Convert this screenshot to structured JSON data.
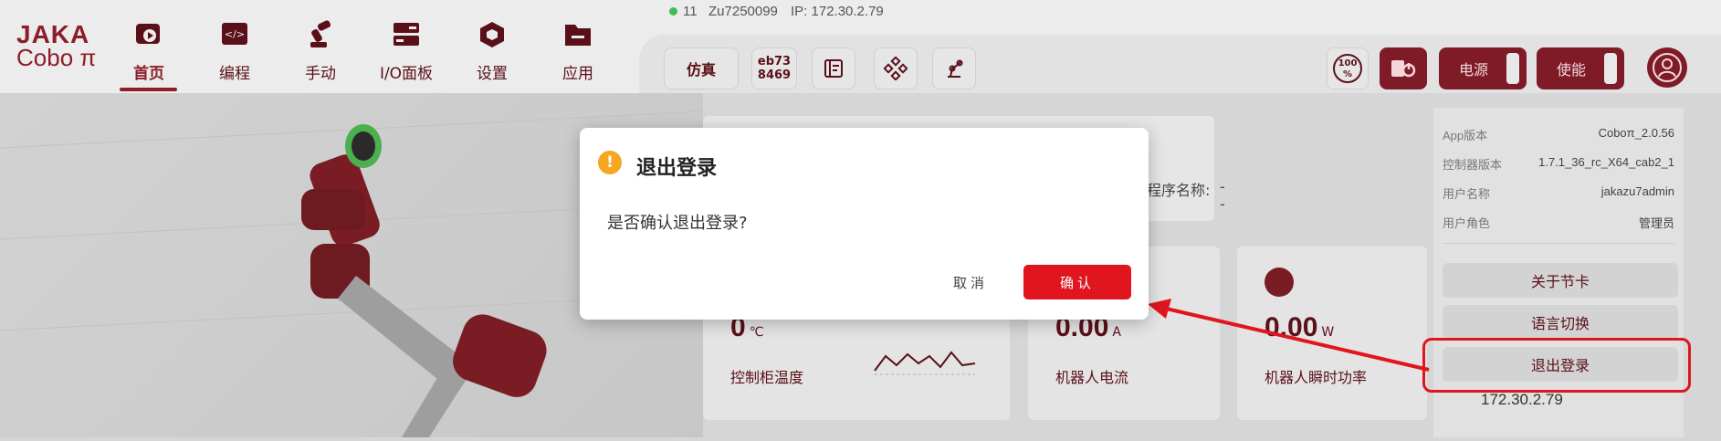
{
  "status": {
    "count": "11",
    "serial": "Zu7250099",
    "ip": "IP: 172.30.2.79"
  },
  "logo": {
    "brand": "JAKA",
    "product": "Cobo π"
  },
  "nav": [
    {
      "label": "首页",
      "icon": "home-icon"
    },
    {
      "label": "编程",
      "icon": "code-icon"
    },
    {
      "label": "手动",
      "icon": "robot-arm-icon"
    },
    {
      "label": "I/O面板",
      "icon": "io-panel-icon"
    },
    {
      "label": "设置",
      "icon": "settings-icon"
    },
    {
      "label": "应用",
      "icon": "folder-icon"
    }
  ],
  "toolbar": {
    "sim_label": "仿真",
    "code_line1": "eb73",
    "code_line2": "8469",
    "speed_value": "100",
    "speed_unit": "%",
    "power_label": "电源",
    "enable_label": "使能"
  },
  "info_card": {
    "program_name_label": "程序名称:",
    "program_name_value": "--"
  },
  "metrics": [
    {
      "value": "0",
      "unit": "℃",
      "label": "控制柜温度"
    },
    {
      "value": "0.00",
      "unit": "A",
      "label": "机器人电流"
    },
    {
      "value": "0.00",
      "unit": "W",
      "label": "机器人瞬时功率"
    }
  ],
  "panel": {
    "rows": [
      {
        "label": "App版本",
        "value": "Coboπ_2.0.56"
      },
      {
        "label": "控制器版本",
        "value": "1.7.1_36_rc_X64_cab2_1"
      },
      {
        "label": "用户名称",
        "value": "jakazu7admin"
      },
      {
        "label": "用户角色",
        "value": "管理员"
      }
    ],
    "about": "关于节卡",
    "language": "语言切换",
    "logout": "退出登录",
    "ip": "172.30.2.79"
  },
  "modal": {
    "title": "退出登录",
    "message": "是否确认退出登录?",
    "cancel": "取消",
    "confirm": "确认"
  },
  "colors": {
    "brand": "#8e1d2a",
    "confirm": "#e0151e",
    "warning": "#f5a623",
    "annotation": "#e0151e"
  }
}
